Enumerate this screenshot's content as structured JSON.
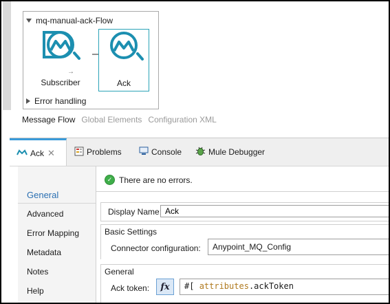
{
  "flow": {
    "name": "mq-manual-ack-Flow",
    "processors": [
      {
        "label": "Subscriber",
        "icon": "anypoint-mq-icon"
      },
      {
        "label": "Ack",
        "icon": "anypoint-mq-icon"
      }
    ],
    "error_handling": "Error handling"
  },
  "editor_tabs": [
    "Message Flow",
    "Global Elements",
    "Configuration XML"
  ],
  "view_tabs": {
    "ack": "Ack",
    "problems": "Problems",
    "console": "Console",
    "debugger": "Mule Debugger"
  },
  "sidebar": {
    "items": [
      "General",
      "Advanced",
      "Error Mapping",
      "Metadata",
      "Notes",
      "Help"
    ],
    "active": "General"
  },
  "status": "There are no errors.",
  "form": {
    "display_name_label": "Display Name:",
    "display_name_value": "Ack",
    "basic_settings_title": "Basic Settings",
    "connector_config_label": "Connector configuration:",
    "connector_config_value": "Anypoint_MQ_Config",
    "general_title": "General",
    "ack_token_label": "Ack token:",
    "fx_label": "fx",
    "expr_prefix": "#[ ",
    "expr_keyword": "attributes",
    "expr_suffix": ".ackToken"
  },
  "colors": {
    "mq_teal": "#1c8fb0",
    "selection_border": "#2aa3b7",
    "active_tab_accent": "#3a9ad9",
    "active_sidebar": "#2a6fb2",
    "ok_green": "#3fae4a"
  }
}
